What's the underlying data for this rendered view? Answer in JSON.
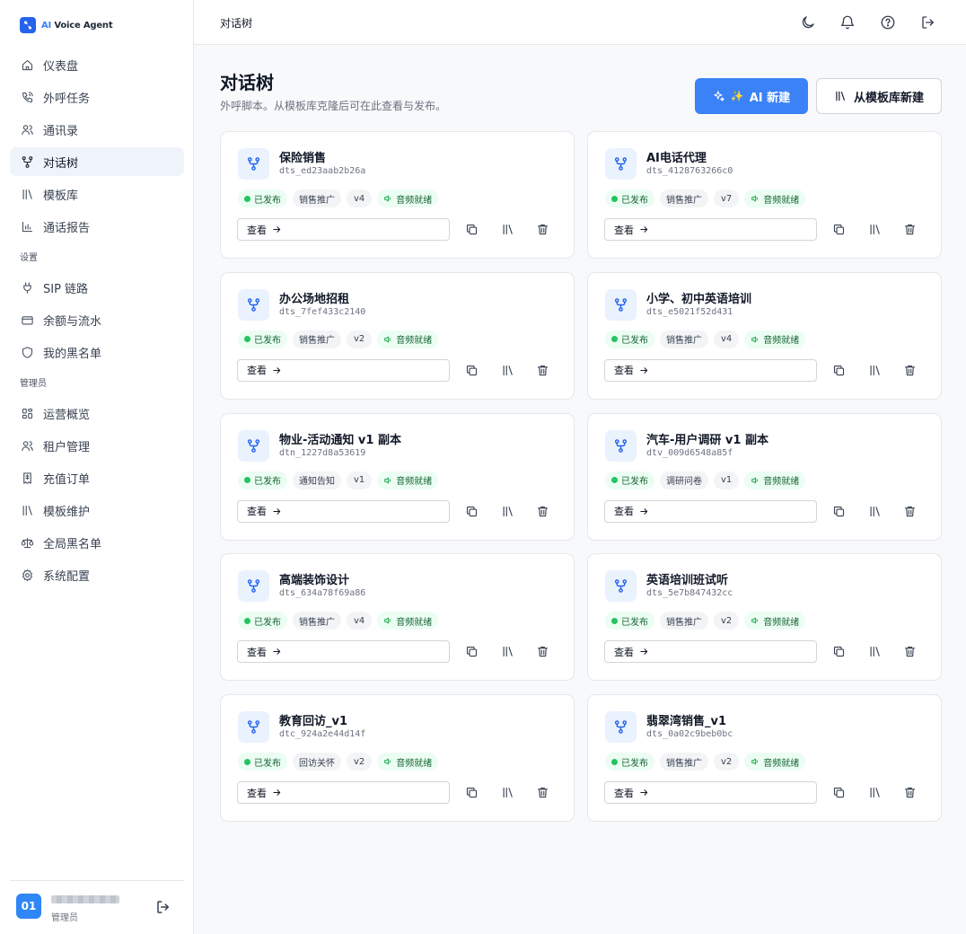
{
  "brand": {
    "prefix": "AI",
    "rest": " Voice Agent"
  },
  "sidebar": {
    "items": [
      {
        "label": "仪表盘",
        "icon": "home-icon"
      },
      {
        "label": "外呼任务",
        "icon": "phone-icon"
      },
      {
        "label": "通讯录",
        "icon": "contacts-icon"
      },
      {
        "label": "对话树",
        "icon": "tree-icon",
        "active": true
      },
      {
        "label": "模板库",
        "icon": "library-icon"
      },
      {
        "label": "通话报告",
        "icon": "bar-chart-icon"
      }
    ],
    "settings_title": "设置",
    "settings_items": [
      {
        "label": "SIP 链路",
        "icon": "plug-icon"
      },
      {
        "label": "余额与流水",
        "icon": "card-icon"
      },
      {
        "label": "我的黑名单",
        "icon": "shield-icon"
      }
    ],
    "admin_title": "管理员",
    "admin_items": [
      {
        "label": "运营概览",
        "icon": "grid-icon"
      },
      {
        "label": "租户管理",
        "icon": "users-icon"
      },
      {
        "label": "充值订单",
        "icon": "receipt-icon"
      },
      {
        "label": "模板维护",
        "icon": "library-icon"
      },
      {
        "label": "全局黑名单",
        "icon": "scale-icon"
      },
      {
        "label": "系统配置",
        "icon": "gear-icon"
      }
    ]
  },
  "user": {
    "avatar": "01",
    "role": "管理员"
  },
  "topbar": {
    "title": "对话树"
  },
  "page": {
    "title": "对话树",
    "subtitle": "外呼脚本。从模板库克隆后可在此查看与发布。",
    "ai_button": "AI 新建",
    "template_button": "从模板库新建"
  },
  "card_labels": {
    "view": "查看",
    "published": "已发布",
    "audio": "音频就绪"
  },
  "cards": [
    {
      "name": "保险销售",
      "id": "dts_ed23aab2b26a",
      "category": "销售推广",
      "version": "v4"
    },
    {
      "name": "AI电话代理",
      "id": "dts_4128763266c0",
      "category": "销售推广",
      "version": "v7"
    },
    {
      "name": "办公场地招租",
      "id": "dts_7fef433c2140",
      "category": "销售推广",
      "version": "v2"
    },
    {
      "name": "小学、初中英语培训",
      "id": "dts_e5021f52d431",
      "category": "销售推广",
      "version": "v4"
    },
    {
      "name": "物业-活动通知 v1 副本",
      "id": "dtn_1227d8a53619",
      "category": "通知告知",
      "version": "v1"
    },
    {
      "name": "汽车-用户调研 v1 副本",
      "id": "dtv_009d6548a85f",
      "category": "调研问卷",
      "version": "v1"
    },
    {
      "name": "高端装饰设计",
      "id": "dts_634a78f69a86",
      "category": "销售推广",
      "version": "v4"
    },
    {
      "name": "英语培训班试听",
      "id": "dts_5e7b847432cc",
      "category": "销售推广",
      "version": "v2"
    },
    {
      "name": "教育回访_v1",
      "id": "dtc_924a2e44d14f",
      "category": "回访关怀",
      "version": "v2"
    },
    {
      "name": "翡翠湾销售_v1",
      "id": "dts_0a02c9beb0bc",
      "category": "销售推广",
      "version": "v2"
    }
  ],
  "colors": {
    "accent": "#3b82f6",
    "published_green": "#22c55e",
    "icon_bg": "#eaf2fe"
  }
}
